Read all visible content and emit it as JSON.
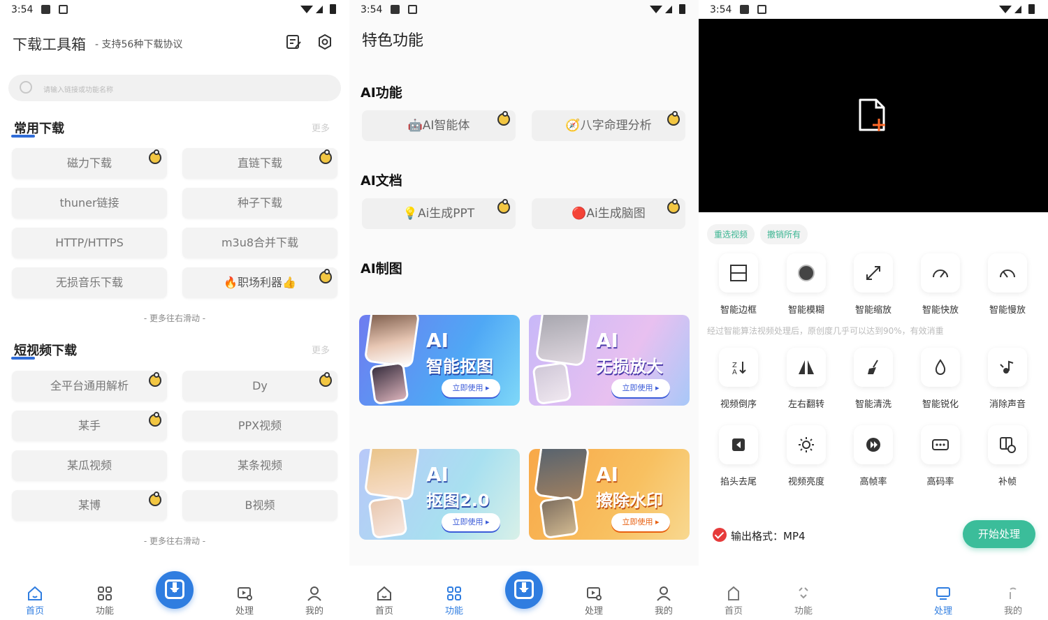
{
  "status": {
    "time": "3:54"
  },
  "screen1": {
    "title": "下载工具箱",
    "subtitle": "- 支持56种下载协议",
    "search_placeholder": "请输入链接或功能名称",
    "section1": {
      "title": "常用下载",
      "more": "更多"
    },
    "section1_items": [
      "磁力下载",
      "直链下载",
      "thuner链接",
      "种子下载",
      "HTTP/HTTPS",
      "m3u8合并下载",
      "无损音乐下载",
      "🔥职场利器👍"
    ],
    "hint1": "- 更多往右滑动 -",
    "section2": {
      "title": "短视频下载",
      "more": "更多"
    },
    "section2_items": [
      "全平台通用解析",
      "Dy",
      "某手",
      "PPX视频",
      "某瓜视频",
      "某条视频",
      "某博",
      "B视频"
    ],
    "hint2": "- 更多往右滑动 -"
  },
  "nav": {
    "home": "首页",
    "func": "功能",
    "process": "处理",
    "mine": "我的"
  },
  "screen2": {
    "title": "特色功能",
    "ai_func": "AI功能",
    "ai_func_items": [
      "🤖AI智能体",
      "🧭八字命理分析"
    ],
    "ai_doc": "AI文档",
    "ai_doc_items": [
      "💡Ai生成PPT",
      "🔴Ai生成脑图"
    ],
    "ai_draw": "AI制图",
    "cards": [
      {
        "line1": "AI",
        "line2": "智能抠图",
        "btn": "立即使用 ▸"
      },
      {
        "line1": "AI",
        "line2": "无损放大",
        "btn": "立即使用 ▸"
      },
      {
        "line1": "AI",
        "line2": "抠图2.0",
        "btn": "立即使用 ▸"
      },
      {
        "line1": "AI",
        "line2": "擦除水印",
        "btn": "立即使用 ▸"
      }
    ]
  },
  "screen3": {
    "tag1": "重选视频",
    "tag2": "撤销所有",
    "tools_row1": [
      {
        "label": "智能边框",
        "icon": "border-icon"
      },
      {
        "label": "智能模糊",
        "icon": "blur-icon"
      },
      {
        "label": "智能缩放",
        "icon": "scale-icon"
      },
      {
        "label": "智能快放",
        "icon": "fast-icon"
      },
      {
        "label": "智能慢放",
        "icon": "slow-icon"
      }
    ],
    "tip": "经过智能算法视频处理后，原创度几乎可以达到90%，有效消重",
    "tools_row2": [
      {
        "label": "视频倒序",
        "icon": "reverse-icon"
      },
      {
        "label": "左右翻转",
        "icon": "flip-icon"
      },
      {
        "label": "智能清洗",
        "icon": "clean-icon"
      },
      {
        "label": "智能锐化",
        "icon": "sharpen-icon"
      },
      {
        "label": "消除声音",
        "icon": "mute-icon"
      }
    ],
    "tools_row3": [
      {
        "label": "掐头去尾",
        "icon": "trim-icon"
      },
      {
        "label": "视频亮度",
        "icon": "brightness-icon"
      },
      {
        "label": "高帧率",
        "icon": "fps-icon"
      },
      {
        "label": "高码率",
        "icon": "bitrate-icon"
      },
      {
        "label": "补帧",
        "icon": "interp-icon"
      }
    ],
    "format": "输出格式：MP4",
    "start": "开始处理"
  },
  "colors": {
    "accent": "#2f7de0",
    "green": "#3bbd9a",
    "highlight": "#d6ef6f"
  }
}
